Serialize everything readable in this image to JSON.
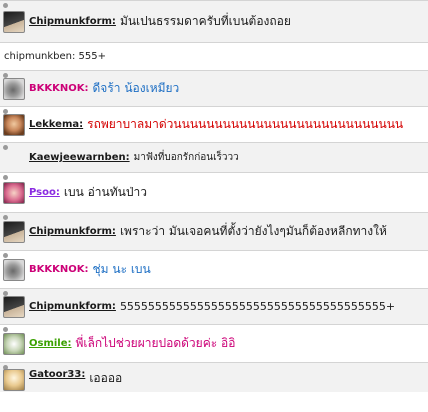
{
  "messages": [
    {
      "user": "Chipmunkform:",
      "text": "มันเปนธรรมดาครับที่เบนต้องถอย",
      "name_color": "#1a1a1a",
      "text_color": "#1a1a1a",
      "avatar": "avatar-dark",
      "style": "normal"
    },
    {
      "user": "",
      "text": "chipmunkben: 555+",
      "name_color": "#222222",
      "text_color": "#222222",
      "avatar": "",
      "style": "plain"
    },
    {
      "user": "BKKKNOK:",
      "text": "ดีจร้า น้องเหมียว",
      "name_color": "#cc0077",
      "text_color": "#1e6fc4",
      "avatar": "avatar-cat",
      "style": "normal"
    },
    {
      "user": "Lekkema:",
      "text": "รถพยาบาลมาด่วนนนนนนนนนนนนนนนนนนนนนนนนนนนน",
      "name_color": "#1a1a1a",
      "text_color": "#d40000",
      "avatar": "avatar-face",
      "style": "normal"
    },
    {
      "user": "Kaewjeewarnben:",
      "text": "มาฟังที่บอกรักก่อนเร็ววว",
      "name_color": "#1a1a1a",
      "text_color": "#1a1a1a",
      "avatar": "",
      "style": "small"
    },
    {
      "user": "Psoo:",
      "text": "เบน อ่านทันป่าว",
      "name_color": "#8a2be2",
      "text_color": "#1a1a1a",
      "avatar": "avatar-pink",
      "style": "normal"
    },
    {
      "user": "Chipmunkform:",
      "text": "เพราะว่า มันเจอคนที่ตั้งว่ายังไงๆมันก็ต้องหลีกทางให้",
      "name_color": "#1a1a1a",
      "text_color": "#1a1a1a",
      "avatar": "avatar-dark",
      "style": "normal"
    },
    {
      "user": "BKKKNOK:",
      "text": "ชุ่ม นะ เบน",
      "name_color": "#cc0077",
      "text_color": "#1e6fc4",
      "avatar": "avatar-cat",
      "style": "normal"
    },
    {
      "user": "Chipmunkform:",
      "text": "55555555555555555555555555555555555555+",
      "name_color": "#1a1a1a",
      "text_color": "#1a1a1a",
      "avatar": "avatar-dark",
      "style": "normal"
    },
    {
      "user": "Osmile:",
      "text": "พี่เล็กไปช่วยผายปอดด้วยค่ะ อิอิ",
      "name_color": "#3aa000",
      "text_color": "#cc0077",
      "avatar": "avatar-green",
      "style": "normal"
    },
    {
      "user": "Gatoor33:",
      "text": "เออออ",
      "name_color": "#1a1a1a",
      "text_color": "#1a1a1a",
      "avatar": "avatar-light",
      "style": "normal"
    }
  ]
}
